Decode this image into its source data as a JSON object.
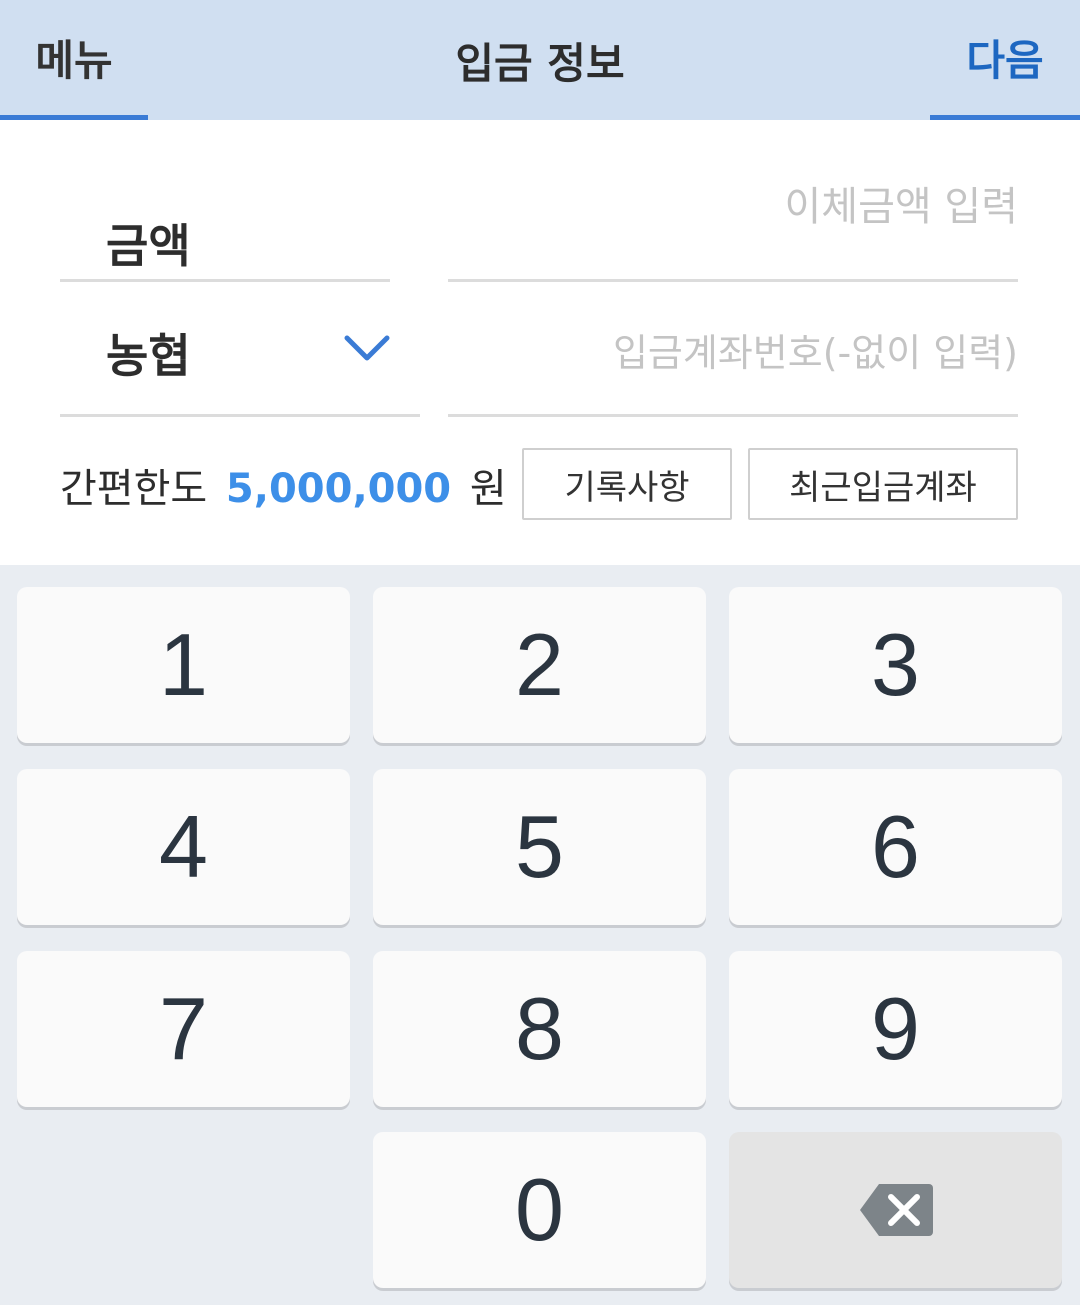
{
  "header": {
    "menu_label": "메뉴",
    "title": "입금 정보",
    "next_label": "다음"
  },
  "form": {
    "amount_label": "금액",
    "amount_placeholder": "이체금액 입력",
    "bank_selected": "농협",
    "account_placeholder": "입금계좌번호(-없이 입력)",
    "limit_label": "간편한도",
    "limit_amount": "5,000,000",
    "limit_unit": "원",
    "history_button": "기록사항",
    "recent_button": "최근입금계좌"
  },
  "keypad": {
    "k1": "1",
    "k2": "2",
    "k3": "3",
    "k4": "4",
    "k5": "5",
    "k6": "6",
    "k7": "7",
    "k8": "8",
    "k9": "9",
    "k0": "0"
  },
  "icons": {
    "dropdown": "chevron-down-icon",
    "backspace": "backspace-icon"
  },
  "colors": {
    "header_bg": "#d0dff1",
    "accent": "#3a7bd5",
    "limit_amount": "#3d8fe8"
  }
}
